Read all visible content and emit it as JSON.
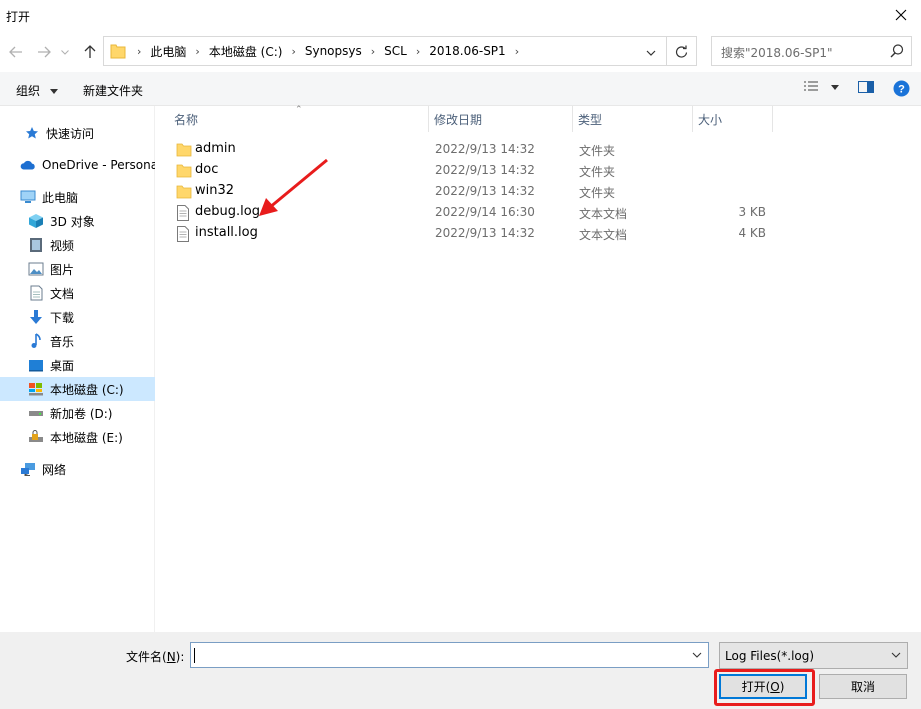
{
  "window": {
    "title": "打开",
    "close_icon": "close-icon"
  },
  "nav": {
    "breadcrumbs": [
      "此电脑",
      "本地磁盘 (C:)",
      "Synopsys",
      "SCL",
      "2018.06-SP1"
    ],
    "search_placeholder": "搜索\"2018.06-SP1\""
  },
  "toolbar": {
    "organize": "组织",
    "new_folder": "新建文件夹"
  },
  "sidebar": {
    "items": [
      {
        "label": "快速访问",
        "icon": "star-icon"
      },
      {
        "label": "OneDrive - Personal",
        "icon": "cloud-icon"
      },
      {
        "label": "此电脑",
        "icon": "computer-icon"
      },
      {
        "label": "3D 对象",
        "icon": "cube-icon"
      },
      {
        "label": "视频",
        "icon": "video-icon"
      },
      {
        "label": "图片",
        "icon": "picture-icon"
      },
      {
        "label": "文档",
        "icon": "document-icon"
      },
      {
        "label": "下载",
        "icon": "download-icon"
      },
      {
        "label": "音乐",
        "icon": "music-icon"
      },
      {
        "label": "桌面",
        "icon": "desktop-icon"
      },
      {
        "label": "本地磁盘 (C:)",
        "icon": "drive-c-icon",
        "selected": true
      },
      {
        "label": "新加卷 (D:)",
        "icon": "drive-icon"
      },
      {
        "label": "本地磁盘 (E:)",
        "icon": "drive-locked-icon"
      },
      {
        "label": "网络",
        "icon": "network-icon"
      }
    ]
  },
  "columns": {
    "name": "名称",
    "modified": "修改日期",
    "type": "类型",
    "size": "大小"
  },
  "files": [
    {
      "name": "admin",
      "modified": "2022/9/13 14:32",
      "type": "文件夹",
      "size": "",
      "kind": "folder"
    },
    {
      "name": "doc",
      "modified": "2022/9/13 14:32",
      "type": "文件夹",
      "size": "",
      "kind": "folder"
    },
    {
      "name": "win32",
      "modified": "2022/9/13 14:32",
      "type": "文件夹",
      "size": "",
      "kind": "folder"
    },
    {
      "name": "debug.log",
      "modified": "2022/9/14 16:30",
      "type": "文本文档",
      "size": "3 KB",
      "kind": "file"
    },
    {
      "name": "install.log",
      "modified": "2022/9/13 14:32",
      "type": "文本文档",
      "size": "4 KB",
      "kind": "file"
    }
  ],
  "footer": {
    "filename_label": "文件名(",
    "filename_key": "N",
    "filename_label_end": "):",
    "filename_value": "",
    "filter": "Log Files(*.log)",
    "open_label": "打开(",
    "open_key": "O",
    "open_label_end": ")",
    "cancel_label": "取消"
  },
  "colors": {
    "selected_bg": "#cce8ff",
    "accent": "#0078d7",
    "annotation_red": "#e81c1c"
  }
}
